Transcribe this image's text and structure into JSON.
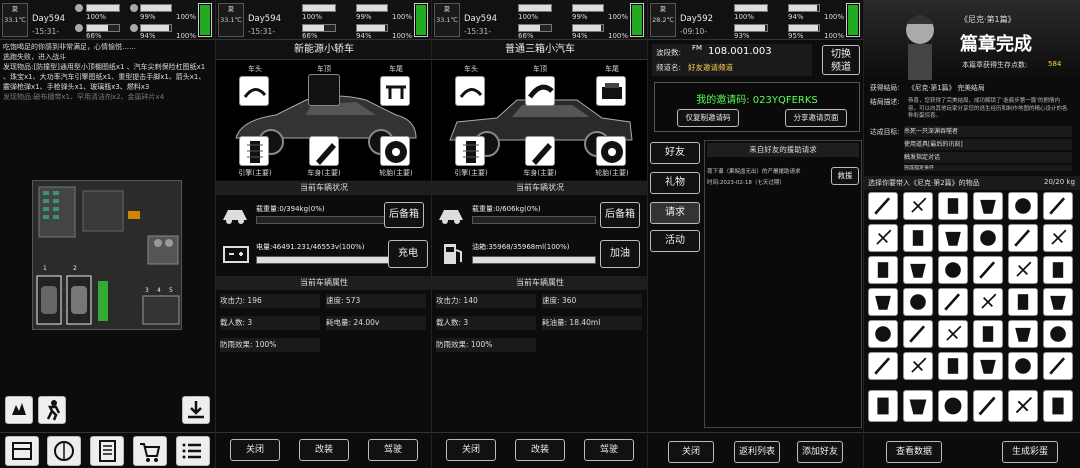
{
  "status_bars": [
    {
      "day": "Day594",
      "time": "-15:31-",
      "temp_top": "夏",
      "temp": "33.1℃",
      "vals": [
        "100%",
        "99%",
        "100%",
        "66%",
        "94%",
        "100%"
      ]
    },
    {
      "day": "Day594",
      "time": "-15:31-",
      "temp_top": "夏",
      "temp": "33.1℃",
      "vals": [
        "100%",
        "99%",
        "100%",
        "66%",
        "94%",
        "100%"
      ]
    },
    {
      "day": "Day594",
      "time": "-15:31-",
      "temp_top": "夏",
      "temp": "33.1℃",
      "vals": [
        "100%",
        "99%",
        "100%",
        "66%",
        "94%",
        "100%"
      ]
    },
    {
      "day": "Day592",
      "time": "-09:10-",
      "temp_top": "夏",
      "temp": "28.2℃",
      "vals": [
        "100%",
        "94%",
        "100%",
        "93%",
        "95%",
        "100%"
      ]
    }
  ],
  "panel1": {
    "log_lines": [
      "吃饱喝足的你感到非常满足，心情愉悦……",
      "逃跑失败，进入战斗",
      "发现物品:[防撞型]通用型小顶棚图纸x1 、汽车尖刺保险杠图纸x1",
      "、珠宝x1、大功率汽车引擎图纸x1、重型提击手脚x1、箭头x1、",
      "霰弹枪弹x1、手枪弹头x1、玻璃瓶x3、燃料x3",
      "发现物品:破布棚带x1、罕用清洁剂x2、金属碎片x4"
    ],
    "map_labels": [
      "1",
      "2",
      "3",
      "4",
      "5"
    ],
    "bottom_icons": [
      "storage-icon",
      "brain-icon",
      "notebook-icon",
      "cart-icon",
      "list-icon"
    ]
  },
  "panel2": {
    "title": "新能源小轿车",
    "slot_top": [
      "车头",
      "车顶",
      "车尾"
    ],
    "slot_bottom": [
      "引擎(主要)",
      "车身(主要)",
      "轮胎(主要)"
    ],
    "status_header": "当前车辆状况",
    "load_text": "载重量:0/394kg(0%)",
    "load_fill": 0,
    "spare_btn": "后备箱",
    "fuel_text": "电量:46491.231/46553v(100%)",
    "fuel_fill": 100,
    "fuel_btn": "充电",
    "attr_header": "当前车辆属性",
    "attrs": [
      [
        "攻击力:",
        "196"
      ],
      [
        "速度:",
        "573"
      ],
      [
        "载人数:",
        "3"
      ],
      [
        "耗电量:",
        "24.00v"
      ],
      [
        "防雨效果:",
        "100%"
      ]
    ],
    "buttons": [
      "关闭",
      "改装",
      "驾驶"
    ]
  },
  "panel3": {
    "title": "普通三箱小汽车",
    "slot_top": [
      "车头",
      "车顶",
      "车尾"
    ],
    "slot_bottom": [
      "引擎(主要)",
      "车身(主要)",
      "轮胎(主要)"
    ],
    "status_header": "当前车辆状况",
    "load_text": "载重量:0/606kg(0%)",
    "load_fill": 0,
    "spare_btn": "后备箱",
    "fuel_text": "油箱:35968/35968ml(100%)",
    "fuel_fill": 100,
    "fuel_btn": "加油",
    "attr_header": "当前车辆属性",
    "attrs": [
      [
        "攻击力:",
        "140"
      ],
      [
        "速度:",
        "360"
      ],
      [
        "载人数:",
        "3"
      ],
      [
        "耗油量:",
        "18.40ml"
      ],
      [
        "防雨效果:",
        "100%"
      ]
    ],
    "buttons": [
      "关闭",
      "改装",
      "驾驶"
    ]
  },
  "panel4": {
    "freq_label": "波段数:",
    "freq_value": "108.001.003",
    "channel_label": "频道名:",
    "channel_value": "好友邀请频道",
    "switch_btn": "切换\n频道",
    "invite_code": "我的邀请码:  023YQFERKS",
    "copy_btn": "仅复制邀请码",
    "share_btn": "分享邀请页面",
    "tabs": [
      "好友",
      "礼物",
      "请求",
      "活动"
    ],
    "request_header": "来自好友的援助请求",
    "request_text": "荷下谱（果皖卤无出）的产屠援助请求",
    "request_time": "时间:2023-02-18（七天过期）",
    "rescue_btn": "救援",
    "buttons": [
      "关闭",
      "返利列表",
      "添加好友"
    ]
  },
  "panel5": {
    "subtitle": "《尼克·第1篇》",
    "chapter_done": "篇章完成",
    "survive_label": "本篇章获得生存点数:",
    "survive_value": "584",
    "ending_label": "获得结局:",
    "ending_value": "《尼克·第1篇》 完美结局",
    "desc_label": "结局描述:",
    "desc_value": "恭喜，您获得了完美结局，成功解锁了‘逝痕步第一篇’的剧情内容，可以向其他玩家分享您的逃生经历和制作地图的精心设计的各种彩蛋惊喜。",
    "goal_label": "达成目标:",
    "goals": [
      "杀死一只深渊吞噬者",
      "使用道具[最后的讯刻]",
      "触发指定对话",
      "完成指定事件"
    ],
    "carry_title": "选择你要带入《尼克·第2篇》的物品",
    "carry_weight": "20/20 kg",
    "check_btn": "查看数据",
    "gen_btn": "生成彩蛋"
  }
}
